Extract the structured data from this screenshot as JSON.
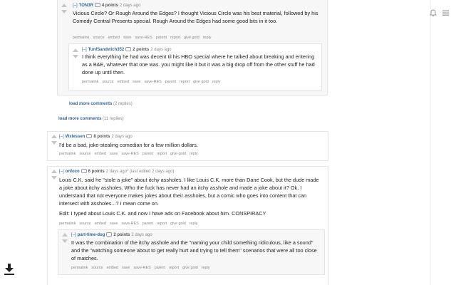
{
  "comments": {
    "c1": {
      "collapse": "[–]",
      "author": "TON3R",
      "score": "4 points",
      "time": "2 days ago",
      "text": [
        "Vicious Circle? Or Rough Around the Edges? I thought Vicious Circle was his best material, followed by his Comedy Central Presents special. Rough Around the Edges had some good bits in it too."
      ],
      "buttons": [
        "permalink",
        "source",
        "embed",
        "save",
        "save-RES",
        "parent",
        "report",
        "give gold",
        "reply"
      ]
    },
    "c2": {
      "collapse": "[–]",
      "author": "TunfSandwich352",
      "score": "2 points",
      "time": "2 days ago",
      "text": [
        "I think everything he had was decent til his HBO special where he talked about breaking and entering as a B&E, whatever that one was. you might like it but it was a big drop off from the other stuff he had done up until then."
      ],
      "buttons": [
        "permalink",
        "source",
        "embed",
        "save",
        "save-RES",
        "parent",
        "report",
        "give gold",
        "reply"
      ]
    },
    "load_more_1": {
      "label": "load more comments",
      "count": "(2 replies)"
    },
    "load_more_2": {
      "label": "load more comments",
      "count": "(11 replies)"
    },
    "c3": {
      "collapse": "[–]",
      "author": "Wxlessen",
      "score": "8 points",
      "time": "2 days ago",
      "text": [
        "I'd be a bad, joke-stealing comedian for a few million dollars."
      ],
      "buttons": [
        "permalink",
        "source",
        "embed",
        "save",
        "save-RES",
        "parent",
        "report",
        "give-gold",
        "reply"
      ]
    },
    "c4": {
      "collapse": "[–]",
      "author": "onfoco",
      "score": "6 points",
      "time": "2 days ago*",
      "edited": "(last edited 2 days ago)",
      "text": [
        "Louis C.K. said he \"stole a joke\" about itchy assholes. I like Louis C.K. more than Dane Cook, but the dude made a joke about itchy assholes. Who the fuck has never had an itchy asshole and made a joke about it? Ok, I understand that not everyone makes jokes about their assholes, but a comic who goes into content that can intersect with assholes...? I mean come on.",
        "Edit: I typed about Louis C.K. and now I have ads on Facebook about him. CONSPIRACY"
      ],
      "buttons": [
        "permalink",
        "source",
        "embed",
        "save",
        "save-RES",
        "parent",
        "report",
        "give gold",
        "reply"
      ]
    },
    "c5": {
      "collapse": "[–]",
      "author": "part-time-dog",
      "score": "2 points",
      "time": "2 days ago",
      "text": [
        "It was the combination of the itchy asshole and the \"naming your child something ridiculous, like a sound\" and the \"watching someone about to get really hurt and trying to tell them\" scenarios that were all too close of matches."
      ],
      "buttons": [
        "permalink",
        "source",
        "embed",
        "save",
        "save-RES",
        "parent",
        "report",
        "give gold",
        "reply"
      ]
    }
  },
  "icons": {
    "upvote": "up-arrow-icon",
    "downvote": "down-arrow-icon",
    "download": "download-icon",
    "notifications": "bell-icon",
    "menu": "menu-icon"
  },
  "colors": {
    "link": "#336699",
    "meta": "#888888",
    "arrow": "#c6c6c6",
    "nested_bg": "#f7f7f8"
  }
}
